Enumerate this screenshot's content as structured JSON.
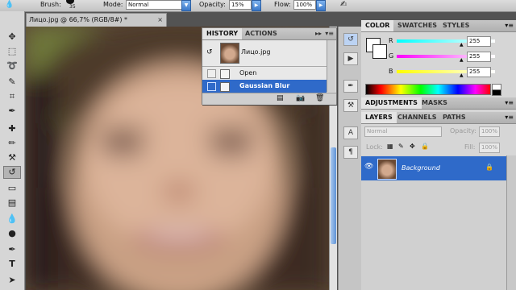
{
  "options_bar": {
    "brush_label": "Brush:",
    "brush_size": "35",
    "mode_label": "Mode:",
    "mode_value": "Normal",
    "opacity_label": "Opacity:",
    "opacity_value": "15%",
    "flow_label": "Flow:",
    "flow_value": "100%"
  },
  "document": {
    "tab_title": "Лицо.jpg @ 66,7% (RGB/8#) *",
    "close_glyph": "×"
  },
  "history": {
    "tabs": [
      "HISTORY",
      "ACTIONS"
    ],
    "snapshot_name": "Лицо.jpg",
    "states": [
      "Open",
      "Gaussian Blur"
    ],
    "selected_state": "Gaussian Blur"
  },
  "color_panel": {
    "tabs": [
      "COLOR",
      "SWATCHES",
      "STYLES"
    ],
    "channels": [
      {
        "name": "R",
        "value": "255"
      },
      {
        "name": "G",
        "value": "255"
      },
      {
        "name": "B",
        "value": "255"
      }
    ]
  },
  "adjustments_panel": {
    "tabs": [
      "ADJUSTMENTS",
      "MASKS"
    ]
  },
  "layers_panel": {
    "tabs": [
      "LAYERS",
      "CHANNELS",
      "PATHS"
    ],
    "blend_mode": "Normal",
    "opacity_label": "Opacity:",
    "opacity_value": "100%",
    "lock_label": "Lock:",
    "fill_label": "Fill:",
    "fill_value": "100%",
    "layer_name": "Background"
  },
  "colors": {
    "selection_blue": "#2f6ac9",
    "panel_gray": "#d6d6d6",
    "workspace_gray": "#535353"
  },
  "icons": [
    "move-icon",
    "marquee-icon",
    "lasso-icon",
    "quick-select-icon",
    "crop-icon",
    "eyedropper-icon",
    "healing-icon",
    "brush-icon",
    "clone-stamp-icon",
    "history-brush-icon",
    "eraser-icon",
    "gradient-icon",
    "blur-icon",
    "dodge-icon",
    "pen-icon",
    "type-icon"
  ]
}
